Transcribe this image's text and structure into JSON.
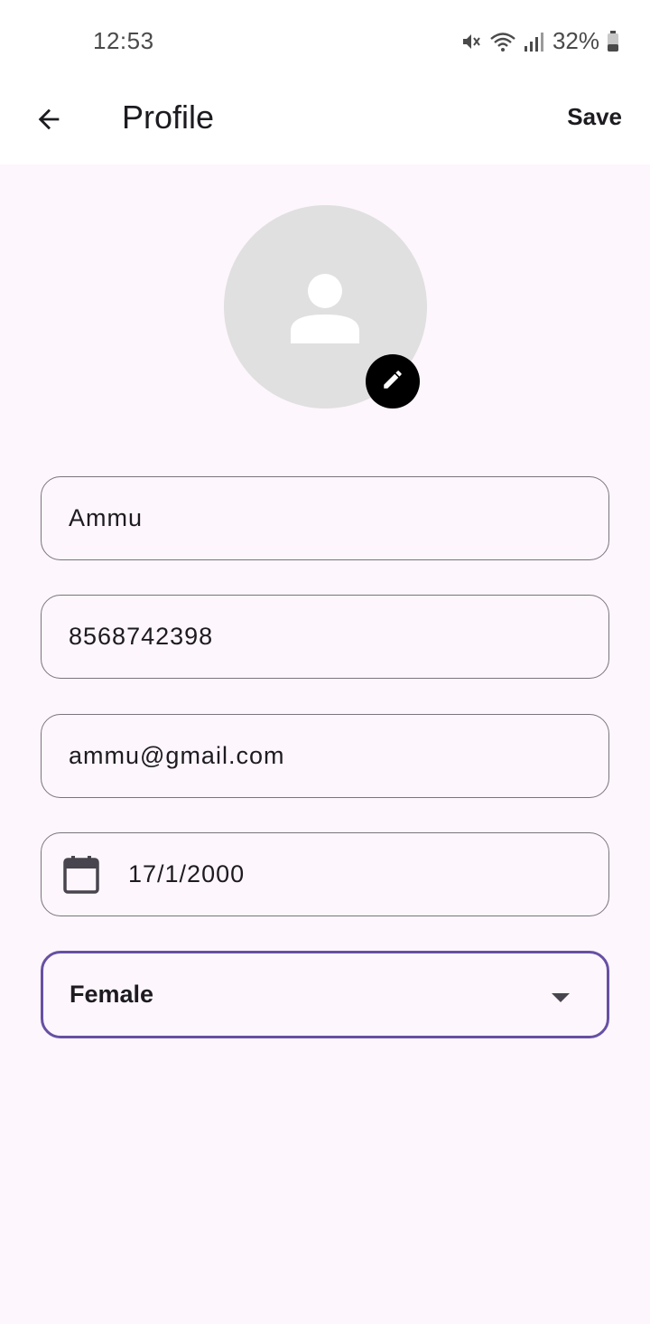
{
  "status_bar": {
    "time": "12:53",
    "battery_percent": "32%",
    "icons": [
      "mute-icon",
      "wifi-icon",
      "signal-icon",
      "battery-icon"
    ]
  },
  "app_bar": {
    "title": "Profile",
    "save_label": "Save",
    "back_icon": "arrow-left-icon"
  },
  "profile": {
    "avatar_icon": "person-icon",
    "edit_icon": "pencil-icon",
    "name": "Ammu",
    "phone": "8568742398",
    "email": "ammu@gmail.com",
    "dob": "17/1/2000",
    "dob_icon": "calendar-icon",
    "gender": "Female"
  },
  "colors": {
    "background": "#fdf6fc",
    "field_border": "#79747e",
    "focused_border": "#6750a4",
    "avatar_bg": "#e0e0e0"
  }
}
